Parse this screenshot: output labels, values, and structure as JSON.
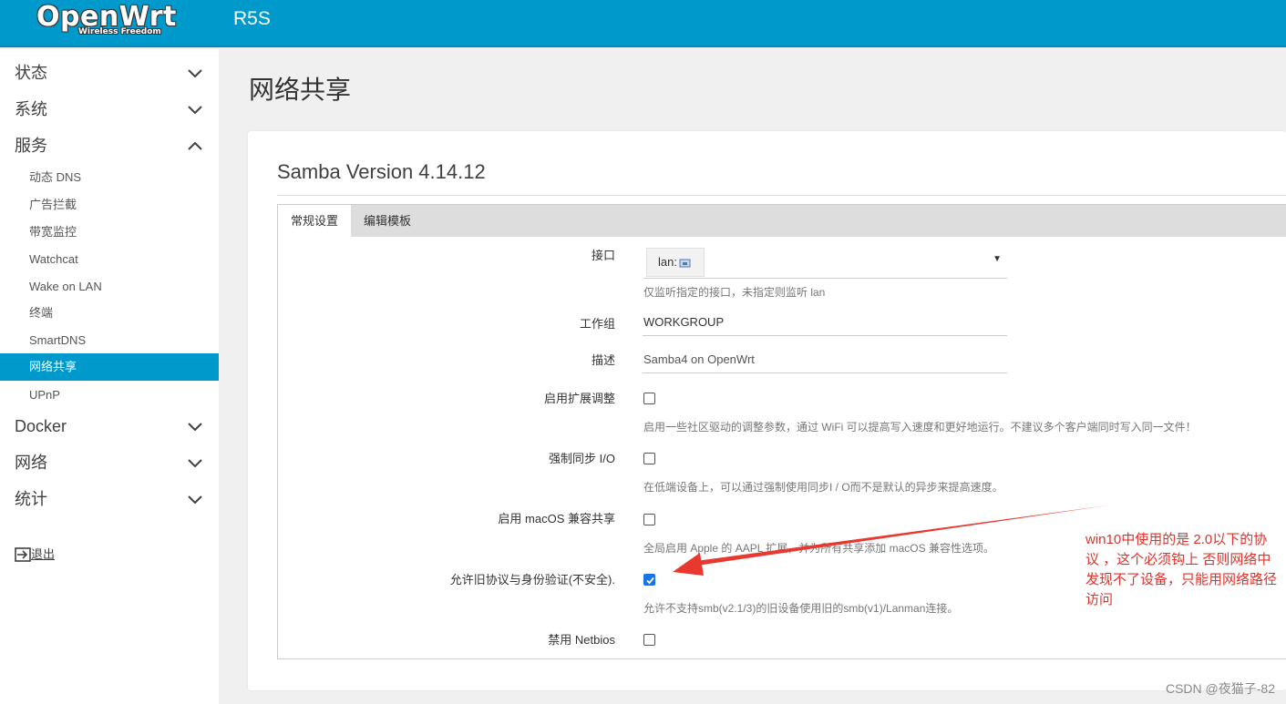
{
  "header": {
    "logo_text": "OpenWrt",
    "logo_tagline": "Wireless Freedom",
    "hostname": "R5S"
  },
  "sidebar": {
    "menus": [
      {
        "label": "状态",
        "expanded": false
      },
      {
        "label": "系统",
        "expanded": false
      },
      {
        "label": "服务",
        "expanded": true
      },
      {
        "label": "Docker",
        "expanded": false
      },
      {
        "label": "网络",
        "expanded": false
      },
      {
        "label": "统计",
        "expanded": false
      }
    ],
    "service_items": [
      {
        "label": "动态 DNS"
      },
      {
        "label": "广告拦截"
      },
      {
        "label": "带宽监控"
      },
      {
        "label": "Watchcat"
      },
      {
        "label": "Wake on LAN"
      },
      {
        "label": "终端"
      },
      {
        "label": "SmartDNS"
      },
      {
        "label": "网络共享",
        "active": true
      },
      {
        "label": "UPnP"
      }
    ],
    "logout_label": "退出"
  },
  "main": {
    "page_title": "网络共享",
    "section_title": "Samba Version 4.14.12",
    "tabs": [
      {
        "label": "常规设置",
        "active": true
      },
      {
        "label": "编辑模板",
        "active": false
      }
    ],
    "form": {
      "interface": {
        "label": "接口",
        "selected": "lan:",
        "description": "仅监听指定的接口，未指定则监听 lan"
      },
      "workgroup": {
        "label": "工作组",
        "value": "WORKGROUP"
      },
      "description_field": {
        "label": "描述",
        "value": "Samba4 on OpenWrt"
      },
      "extended_tuning": {
        "label": "启用扩展调整",
        "checked": false,
        "description": "启用一些社区驱动的调整参数，通过 WiFi 可以提高写入速度和更好地运行。不建议多个客户端同时写入同一文件！"
      },
      "force_sync_io": {
        "label": "强制同步 I/O",
        "checked": false,
        "description": "在低端设备上，可以通过强制使用同步I / O而不是默认的异步来提高速度。"
      },
      "macos_compat": {
        "label": "启用 macOS 兼容共享",
        "checked": false,
        "description": "全局启用 Apple 的 AAPL 扩展，并为所有共享添加 macOS 兼容性选项。"
      },
      "legacy_auth": {
        "label": "允许旧协议与身份验证(不安全).",
        "checked": true,
        "description": "允许不支持smb(v2.1/3)的旧设备使用旧的smb(v1)/Lanman连接。"
      },
      "disable_netbios": {
        "label": "禁用 Netbios",
        "checked": false
      }
    }
  },
  "annotation": {
    "text": "win10中使用的是 2.0以下的协议 ，这个必须钩上 否则网络中发现不了设备，只能用网络路径访问",
    "color": "#e0322b"
  },
  "watermark": "CSDN @夜猫子-82",
  "colors": {
    "header": "#0099cc",
    "active_item": "#0099cc",
    "checkbox_checked": "#1a73e8"
  }
}
